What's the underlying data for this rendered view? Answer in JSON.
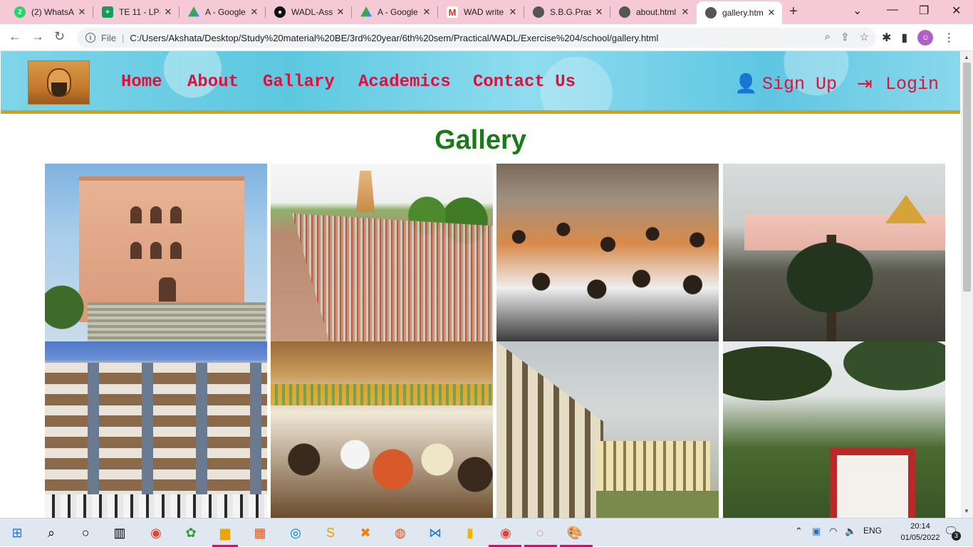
{
  "browser": {
    "tabs": [
      {
        "title": "(2) WhatsA",
        "icon": "whatsapp-icon",
        "badge": "2"
      },
      {
        "title": "TE 11 - LP-",
        "icon": "sheets-icon"
      },
      {
        "title": "A - Google",
        "icon": "drive-icon"
      },
      {
        "title": "WADL-Ass",
        "icon": "github-icon"
      },
      {
        "title": "A - Google",
        "icon": "drive-icon"
      },
      {
        "title": "WAD write",
        "icon": "gmail-icon"
      },
      {
        "title": "S.B.G.Prash",
        "icon": "globe-icon"
      },
      {
        "title": "about.html",
        "icon": "globe-icon"
      },
      {
        "title": "gallery.htm",
        "icon": "globe-icon",
        "active": true
      }
    ],
    "address": {
      "scheme_label": "File",
      "url": "C:/Users/Akshata/Desktop/Study%20material%20BE/3rd%20year/6th%20sem/Practical/WADL/Exercise%204/school/gallery.html"
    }
  },
  "site": {
    "nav": {
      "home": "Home",
      "about": "About",
      "gallery": "Gallary",
      "academics": "Academics",
      "contact": "Contact Us",
      "signup": "Sign Up",
      "login": "Login"
    },
    "page_title": "Gallery",
    "colors": {
      "nav_text": "#e0103c",
      "title": "#1a7a1a",
      "header_border": "#d4a017"
    }
  },
  "taskbar": {
    "lang": "ENG",
    "time": "20:14",
    "date": "01/05/2022",
    "notifications": "3"
  }
}
